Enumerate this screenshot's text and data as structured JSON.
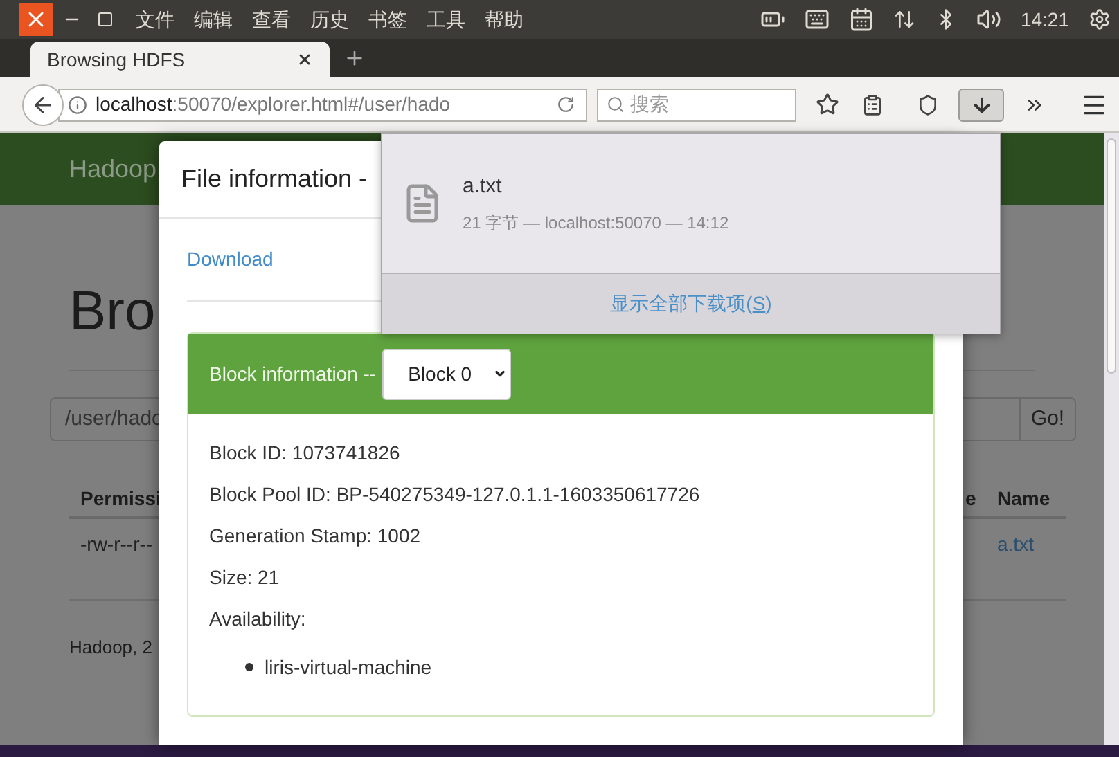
{
  "system_bar": {
    "menus": [
      "文件",
      "编辑",
      "查看",
      "历史",
      "书签",
      "工具",
      "帮助"
    ],
    "clock": "14:21"
  },
  "tabs": [
    {
      "label": "Browsing HDFS",
      "selected": true
    }
  ],
  "address_bar": {
    "host": "localhost",
    "rest": ":50070/explorer.html#/user/hado"
  },
  "search": {
    "placeholder": "搜索"
  },
  "page": {
    "brand": "Hadoop",
    "heading": "Bro",
    "path_value": "/user/hado",
    "go_button": "Go!",
    "columns": [
      "Permissi",
      "e",
      "Name"
    ],
    "row": [
      "-rw-r--r--",
      "a.txt"
    ],
    "footer": "Hadoop, 2"
  },
  "modal": {
    "title": "File information -",
    "download": "Download",
    "block_label": "Block information --",
    "block_select": "Block 0",
    "fields": [
      "Block ID: 1073741826",
      "Block Pool ID: BP-540275349-127.0.1.1-1603350617726",
      "Generation Stamp: 1002",
      "Size: 21",
      "Availability:"
    ],
    "hosts": [
      "liris-virtual-machine"
    ]
  },
  "downloads_panel": {
    "items": [
      {
        "name": "a.txt",
        "detail": "21 字节 — localhost:50070 — 14:12"
      }
    ],
    "show_all": "显示全部下载项(",
    "access_key": "S",
    "show_all_end": ")"
  }
}
